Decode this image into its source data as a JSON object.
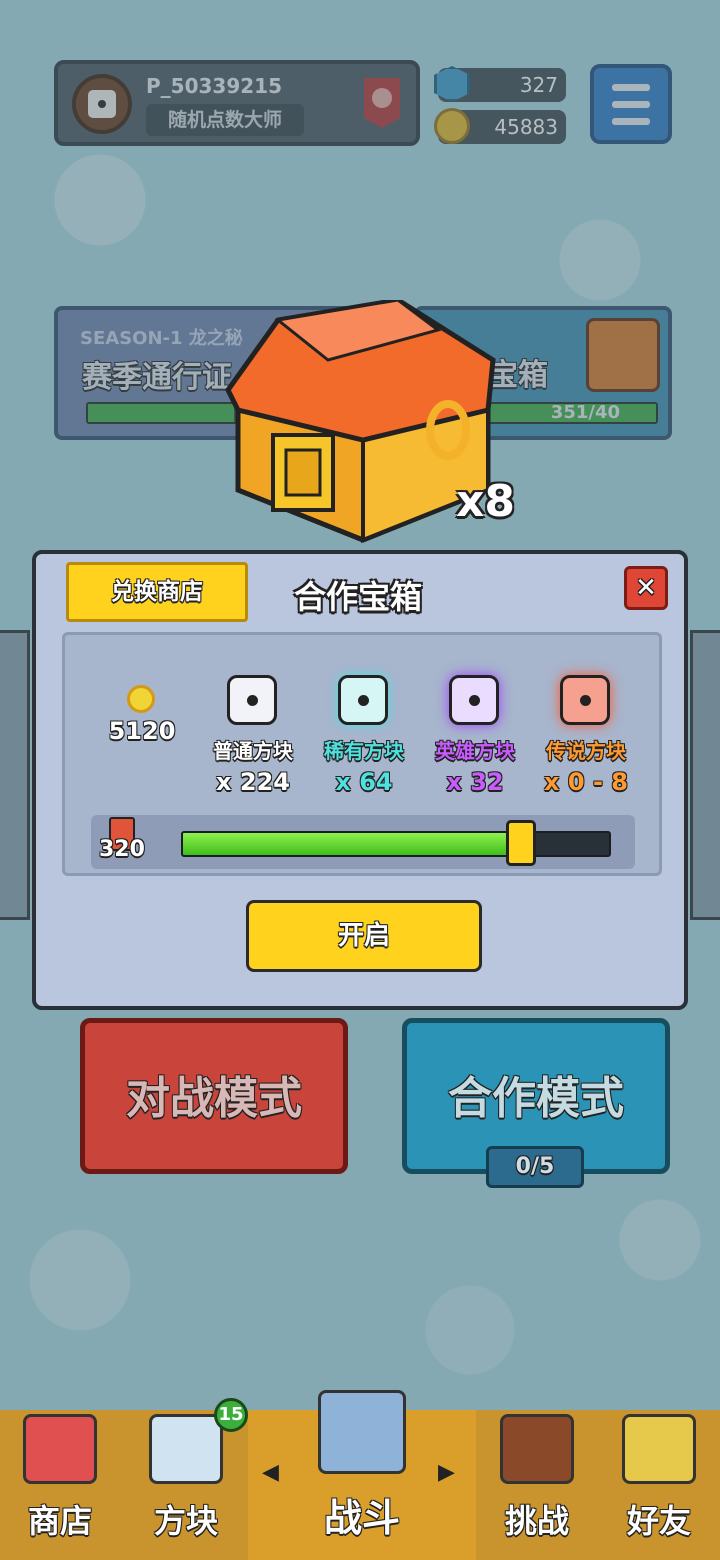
{
  "header": {
    "player_id": "P_50339215",
    "player_title": "随机点数大师",
    "gems": "327",
    "coins": "45883"
  },
  "season": {
    "tag": "SEASON-1 龙之秘",
    "title": "赛季通行证",
    "progress": 0.55
  },
  "chest_card": {
    "title": "宝箱",
    "progress_text": "351/40"
  },
  "big_chest": {
    "multiplier": "x8"
  },
  "modal": {
    "exchange_label": "兑换商店",
    "title": "合作宝箱",
    "close_label": "✕",
    "rewards": [
      {
        "label": "",
        "count": "5120",
        "color": "#ffffff"
      },
      {
        "label": "普通方块",
        "count": "x 224",
        "color": "#ffffff"
      },
      {
        "label": "稀有方块",
        "count": "x 64",
        "color": "#4fe0e0"
      },
      {
        "label": "英雄方块",
        "count": "x 32",
        "color": "#c85cff"
      },
      {
        "label": "传说方块",
        "count": "x 0 - 8",
        "color": "#ff9a30"
      }
    ],
    "cards_count": "320",
    "slider_progress": 0.79,
    "open_label": "开启"
  },
  "modes": {
    "battle_label": "对战模式",
    "coop_label": "合作模式",
    "coop_count": "0/5"
  },
  "nav": {
    "shop": "商店",
    "dice": "方块",
    "battle": "战斗",
    "challenge": "挑战",
    "friends": "好友",
    "dice_badge": "15"
  },
  "colors": {
    "accent_yellow": "#ffd21d",
    "close_red": "#e04636",
    "slider_green": "#5fd82c"
  }
}
